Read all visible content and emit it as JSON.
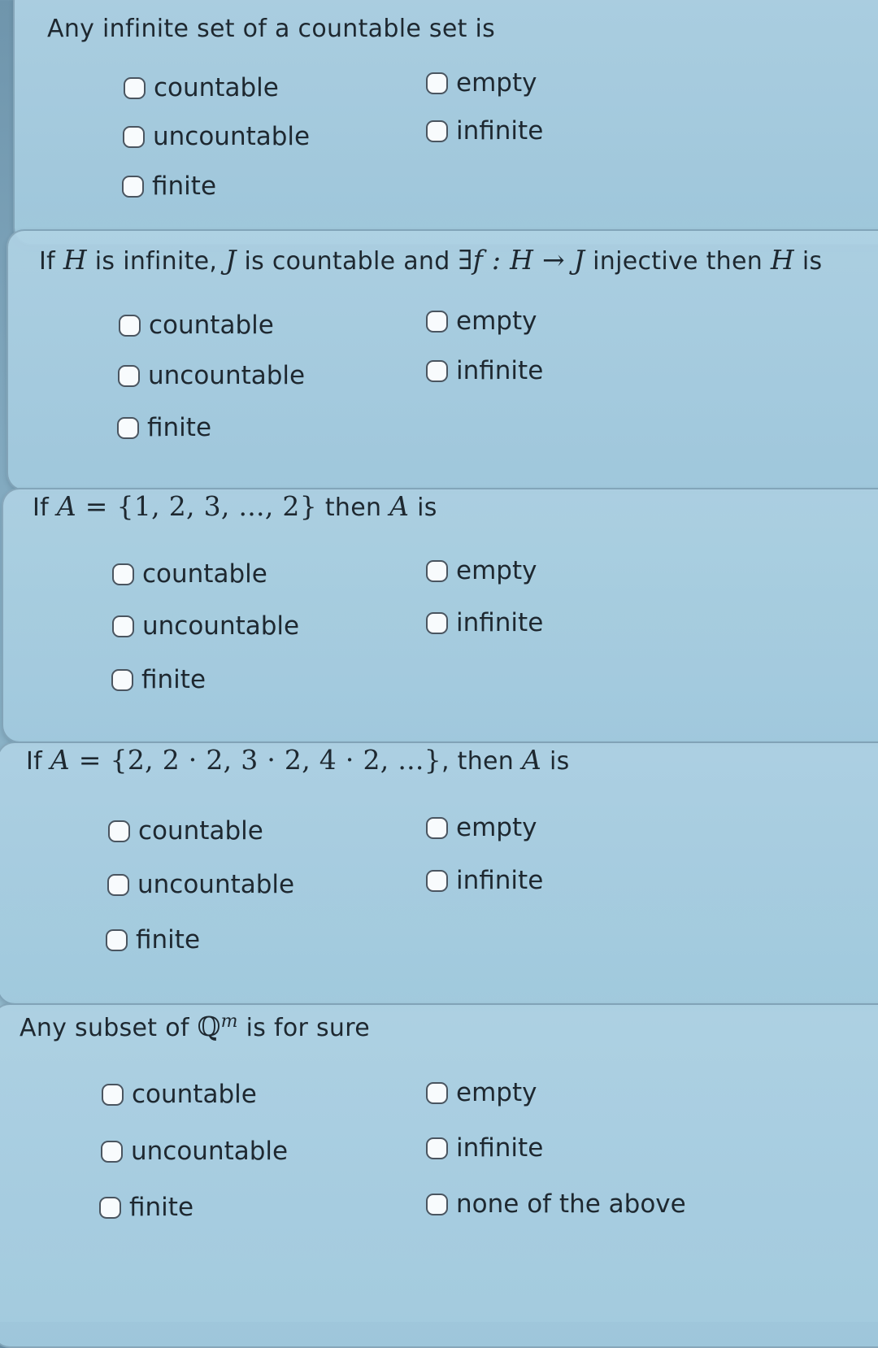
{
  "questions": [
    {
      "prompt": "Any infinite set of a countable set is",
      "options": [
        "countable",
        "uncountable",
        "finite",
        "empty",
        "infinite"
      ]
    },
    {
      "prompt_parts": [
        "If ",
        "H",
        " is infinite, ",
        "J",
        " is countable and ",
        "∃f : H → J",
        " injective then ",
        "H",
        " is"
      ],
      "options": [
        "countable",
        "uncountable",
        "finite",
        "empty",
        "infinite"
      ]
    },
    {
      "prompt_parts": [
        "If ",
        "A",
        " = {1, 2, 3, ..., 2}",
        " then ",
        "A",
        " is"
      ],
      "options": [
        "countable",
        "uncountable",
        "finite",
        "empty",
        "infinite"
      ]
    },
    {
      "prompt_parts": [
        "If ",
        "A",
        " = {2, 2 · 2, 3 · 2, 4 · 2, ...}",
        ", then ",
        "A",
        " is"
      ],
      "options": [
        "countable",
        "uncountable",
        "finite",
        "empty",
        "infinite"
      ]
    },
    {
      "prompt_parts": [
        "Any subset of ",
        "ℚ",
        "m",
        " is for sure"
      ],
      "options": [
        "countable",
        "uncountable",
        "finite",
        "empty",
        "infinite",
        "none of the above"
      ]
    }
  ]
}
